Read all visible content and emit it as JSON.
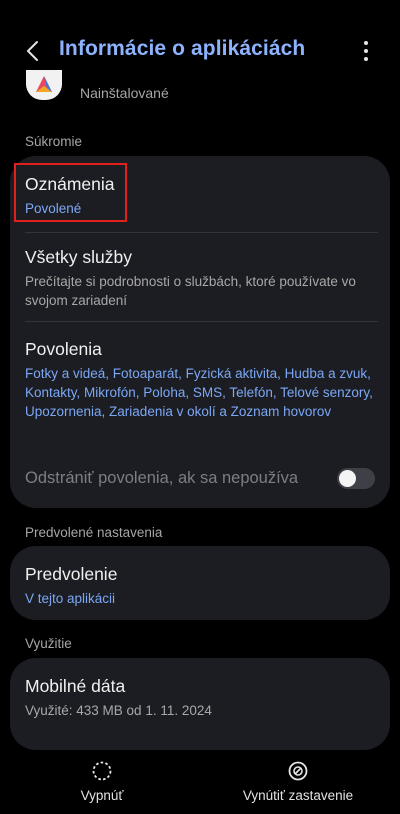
{
  "header": {
    "title": "Informácie o aplikáciách",
    "back_icon": "back-arrow-icon",
    "more_icon": "more-vertical-icon"
  },
  "app": {
    "status": "Nainštalované",
    "icon": "app-logo-icon"
  },
  "sections": {
    "privacy": "Súkromie",
    "defaults": "Predvolené nastavenia",
    "usage": "Využitie"
  },
  "items": {
    "notifications": {
      "title": "Oznámenia",
      "sub": "Povolené"
    },
    "all_services": {
      "title": "Všetky služby",
      "sub": "Prečítajte si podrobnosti o službách, ktoré používate vo svojom zariadení"
    },
    "permissions": {
      "title": "Povolenia",
      "sub": "Fotky a videá, Fotoaparát, Fyzická aktivita, Hudba a zvuk, Kontakty, Mikrofón, Poloha, SMS, Telefón, Telové senzory, Upozornenia, Zariadenia v okolí a Zoznam hovorov"
    },
    "remove_permissions": {
      "label": "Odstrániť povolenia, ak sa nepoužíva",
      "enabled": false
    },
    "defaults": {
      "title": "Predvolenie",
      "sub": "V tejto aplikácii"
    },
    "mobile_data": {
      "title": "Mobilné dáta",
      "sub": "Využité: 433 MB od 1. 11. 2024"
    }
  },
  "bottom_bar": {
    "disable": {
      "label": "Vypnúť",
      "icon": "dashed-circle-icon"
    },
    "force_stop": {
      "label": "Vynútiť zastavenie",
      "icon": "stop-circle-icon"
    }
  },
  "colors": {
    "accent": "#8db3ff",
    "link": "#7ba7f5",
    "card": "#1c1d22",
    "highlight": "#e0201c"
  }
}
